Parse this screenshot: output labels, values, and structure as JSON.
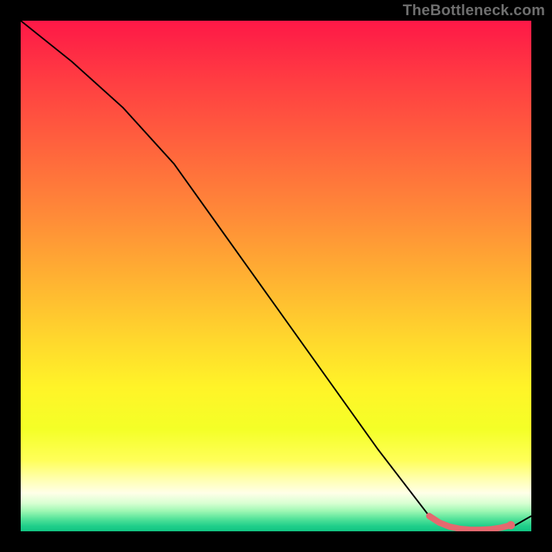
{
  "watermark": "TheBottleneck.com",
  "chart_data": {
    "type": "line",
    "title": "",
    "xlabel": "",
    "ylabel": "",
    "xlim": [
      0,
      100
    ],
    "ylim": [
      0,
      100
    ],
    "grid": false,
    "legend": false,
    "series": [
      {
        "name": "bottleneck-curve",
        "color": "#000000",
        "width": 2.2,
        "x": [
          0,
          10,
          20,
          30,
          40,
          50,
          60,
          70,
          80,
          84,
          88,
          92,
          96,
          100
        ],
        "y": [
          100,
          92,
          83,
          72,
          58,
          44,
          30,
          16,
          3,
          0.5,
          0.2,
          0.2,
          0.7,
          3
        ]
      },
      {
        "name": "optimal-band",
        "color": "#e4696f",
        "width": 9,
        "linecap": "round",
        "x": [
          80,
          82,
          84,
          86,
          88,
          90,
          92,
          94,
          96
        ],
        "y": [
          3.0,
          1.7,
          0.9,
          0.5,
          0.3,
          0.3,
          0.4,
          0.7,
          1.2
        ]
      }
    ],
    "markers": [
      {
        "name": "optimal-point",
        "x": 96,
        "y": 1.2,
        "r": 6,
        "color": "#e4696f"
      }
    ],
    "background_gradient": {
      "stops": [
        {
          "offset": 0.0,
          "color": "#fe1847"
        },
        {
          "offset": 0.12,
          "color": "#ff3e42"
        },
        {
          "offset": 0.25,
          "color": "#ff643d"
        },
        {
          "offset": 0.38,
          "color": "#ff8a38"
        },
        {
          "offset": 0.5,
          "color": "#ffb032"
        },
        {
          "offset": 0.62,
          "color": "#ffd62d"
        },
        {
          "offset": 0.72,
          "color": "#fff428"
        },
        {
          "offset": 0.8,
          "color": "#f4ff27"
        },
        {
          "offset": 0.86,
          "color": "#ffff58"
        },
        {
          "offset": 0.9,
          "color": "#ffffb4"
        },
        {
          "offset": 0.925,
          "color": "#ffffe8"
        },
        {
          "offset": 0.945,
          "color": "#d8ffd2"
        },
        {
          "offset": 0.96,
          "color": "#a0f8b4"
        },
        {
          "offset": 0.975,
          "color": "#58e49b"
        },
        {
          "offset": 0.99,
          "color": "#1fce8a"
        },
        {
          "offset": 1.0,
          "color": "#12c583"
        }
      ]
    }
  }
}
